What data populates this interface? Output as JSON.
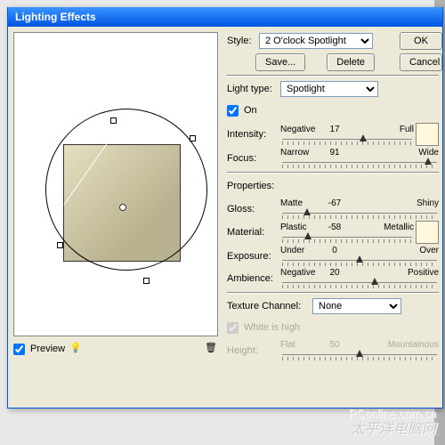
{
  "title": "Lighting Effects",
  "style_label": "Style:",
  "style_value": "2 O'clock Spotlight",
  "ok": "OK",
  "cancel": "Cancel",
  "save": "Save...",
  "delete": "Delete",
  "light_type_label": "Light type:",
  "light_type_value": "Spotlight",
  "on": "On",
  "intensity": {
    "label": "Intensity:",
    "left": "Negative",
    "val": "17",
    "right": "Full",
    "pos": 62
  },
  "focus": {
    "label": "Focus:",
    "left": "Narrow",
    "val": "91",
    "right": "Wide",
    "pos": 94
  },
  "properties": "Properties:",
  "gloss": {
    "label": "Gloss:",
    "left": "Matte",
    "val": "-67",
    "right": "Shiny",
    "pos": 16
  },
  "material": {
    "label": "Material:",
    "left": "Plastic",
    "val": "-58",
    "right": "Metallic",
    "pos": 20
  },
  "exposure": {
    "label": "Exposure:",
    "left": "Under",
    "val": "0",
    "right": "Over",
    "pos": 50
  },
  "ambience": {
    "label": "Ambience:",
    "left": "Negative",
    "val": "20",
    "right": "Positive",
    "pos": 60
  },
  "texture_label": "Texture Channel:",
  "texture_value": "None",
  "white": "White is high",
  "height": {
    "label": "Height:",
    "left": "Flat",
    "val": "50",
    "right": "Mountainous",
    "pos": 50
  },
  "preview": "Preview",
  "wm1": "PConline.com.cn",
  "wm2": "太平洋电脑网"
}
